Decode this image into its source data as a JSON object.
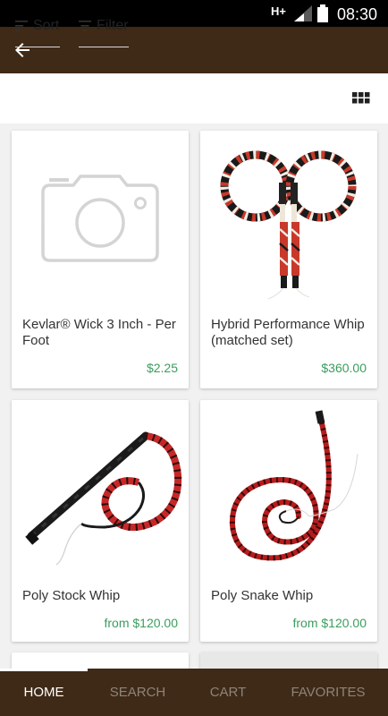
{
  "status_bar": {
    "network": "H+",
    "time": "08:30"
  },
  "toolbar": {
    "sort_label": "Sort",
    "filter_label": "Filter"
  },
  "products": [
    {
      "name": "Kevlar® Wick 3 Inch - Per Foot",
      "price": "$2.25",
      "image": "camera-placeholder-icon"
    },
    {
      "name": "Hybrid Performance Whip (matched set)",
      "price": "$360.00",
      "image": "whip-pair-photo"
    },
    {
      "name": "Poly Stock Whip",
      "price": "from $120.00",
      "image": "stock-whip-photo"
    },
    {
      "name": "Poly Snake Whip",
      "price": "from $120.00",
      "image": "snake-whip-photo"
    }
  ],
  "bottom_nav": {
    "active": "HOME",
    "tabs": [
      {
        "label": "HOME"
      },
      {
        "label": "SEARCH"
      },
      {
        "label": "CART"
      },
      {
        "label": "FAVORITES"
      }
    ]
  },
  "colors": {
    "header": "#3f2a17",
    "price": "#3a9d5d",
    "background": "#f1f1f1"
  }
}
